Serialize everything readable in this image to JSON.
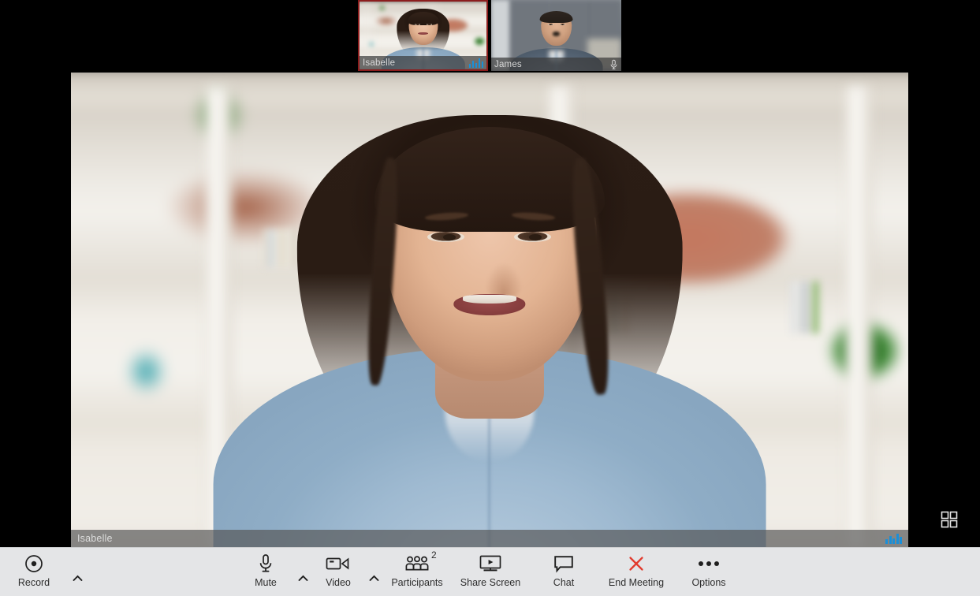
{
  "app": {
    "title": "Video Meeting",
    "accent": "#1a8fd8",
    "danger": "#e23b2e",
    "active_border": "#8c1d1d"
  },
  "thumbnails": [
    {
      "name": "Isabelle",
      "active": true,
      "indicator": "audio-level-icon",
      "audio_levels": [
        5,
        9,
        6,
        12,
        8
      ]
    },
    {
      "name": "James",
      "active": false,
      "indicator": "microphone-muted-icon",
      "audio_levels": []
    }
  ],
  "main_video": {
    "name": "Isabelle",
    "indicator": "audio-level-icon",
    "audio_levels": [
      6,
      10,
      7,
      13,
      9
    ]
  },
  "gallery_button": {
    "icon": "grid-view-icon",
    "label": ""
  },
  "toolbar": {
    "items": [
      {
        "label": "Record",
        "icon": "record-icon",
        "caret": true,
        "badge": ""
      },
      {
        "label": "Mute",
        "icon": "microphone-icon",
        "caret": true,
        "badge": ""
      },
      {
        "label": "Video",
        "icon": "video-camera-icon",
        "caret": true,
        "badge": ""
      },
      {
        "label": "Participants",
        "icon": "participants-icon",
        "caret": false,
        "badge": "2"
      },
      {
        "label": "Share Screen",
        "icon": "share-screen-icon",
        "caret": false,
        "badge": ""
      },
      {
        "label": "Chat",
        "icon": "chat-bubble-icon",
        "caret": false,
        "badge": ""
      },
      {
        "label": "End Meeting",
        "icon": "close-x-icon",
        "caret": false,
        "badge": ""
      },
      {
        "label": "Options",
        "icon": "ellipsis-icon",
        "caret": false,
        "badge": ""
      }
    ]
  }
}
